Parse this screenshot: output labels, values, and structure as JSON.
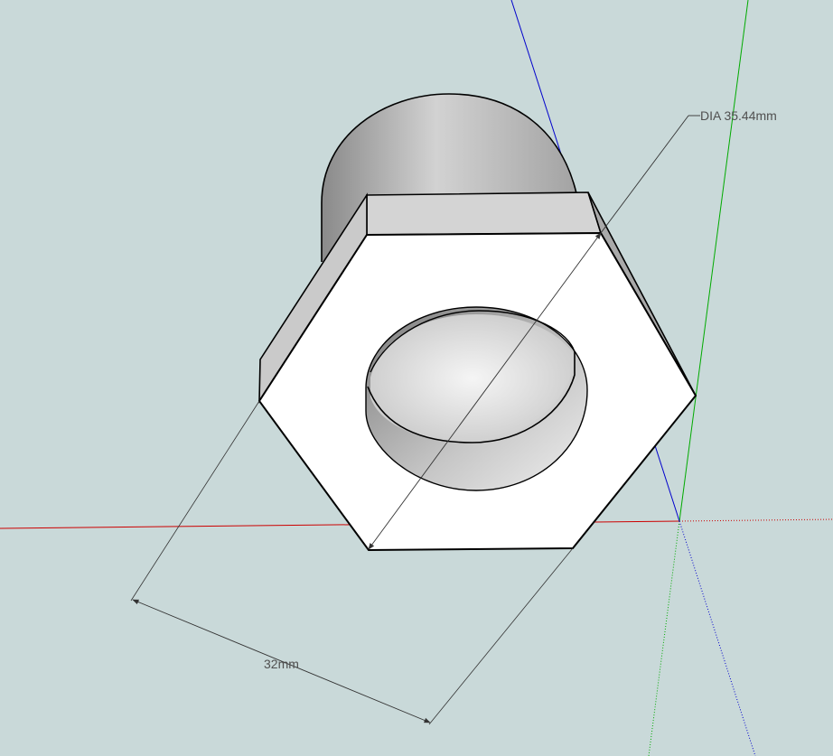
{
  "dimensions": {
    "diameter_label": "DIA 35.44mm",
    "length_label": "32mm"
  },
  "colors": {
    "background": "#c9d9d9",
    "x_axis": "#cc0000",
    "y_axis": "#00aa00",
    "z_axis": "#0000cc",
    "dimension_line": "#333333",
    "edge": "#000000"
  }
}
